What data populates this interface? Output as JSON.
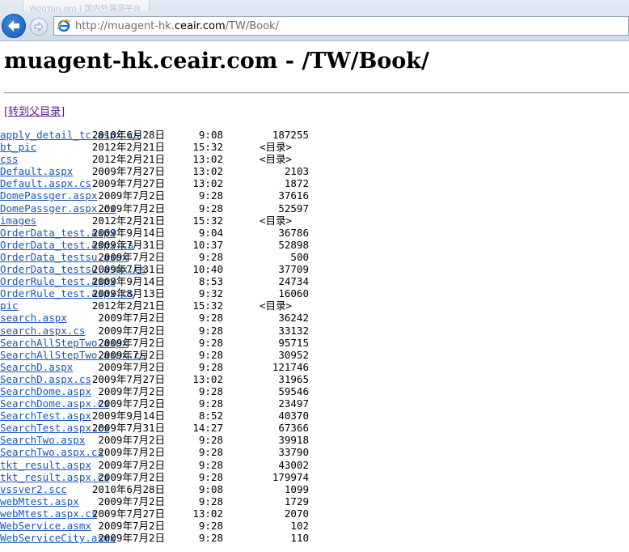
{
  "browser": {
    "ghost_tab_text": "WooYun.org | 国内外漏洞平台",
    "address": {
      "prefix": "http://muagent-hk.",
      "host": "ceair.com",
      "suffix": "/TW/Book/"
    }
  },
  "page": {
    "title": "muagent-hk.ceair.com - /TW/Book/",
    "parent_link": "[转到父目录]"
  },
  "listing": [
    {
      "date": "2010年6月28日",
      "time": "9:08",
      "size": "187255",
      "name": "apply_detail_tc.aspx.cs"
    },
    {
      "date": "2012年2月21日",
      "time": "15:32",
      "dir": "<目录>",
      "name": "bt_pic"
    },
    {
      "date": "2012年2月21日",
      "time": "13:02",
      "dir": "<目录>",
      "name": "css"
    },
    {
      "date": "2009年7月27日",
      "time": "13:02",
      "size": "2103",
      "name": "Default.aspx"
    },
    {
      "date": "2009年7月27日",
      "time": "13:02",
      "size": "1872",
      "name": "Default.aspx.cs"
    },
    {
      "date": "2009年7月2日",
      "time": "9:28",
      "size": "37616",
      "name": "DomePassger.aspx"
    },
    {
      "date": "2009年7月2日",
      "time": "9:28",
      "size": "52597",
      "name": "DomePassger.aspx.cs"
    },
    {
      "date": "2012年2月21日",
      "time": "15:32",
      "dir": "<目录>",
      "name": "images"
    },
    {
      "date": "2009年9月14日",
      "time": "9:04",
      "size": "36786",
      "name": "OrderData_test.aspx"
    },
    {
      "date": "2009年7月31日",
      "time": "10:37",
      "size": "52898",
      "name": "OrderData_test.aspx.cs"
    },
    {
      "date": "2009年7月2日",
      "time": "9:28",
      "size": "500",
      "name": "OrderData_testsu.aspx"
    },
    {
      "date": "2009年7月31日",
      "time": "10:40",
      "size": "37709",
      "name": "OrderData_testsu.aspx.cs"
    },
    {
      "date": "2009年9月14日",
      "time": "8:53",
      "size": "24734",
      "name": "OrderRule_test.aspx"
    },
    {
      "date": "2009年8月13日",
      "time": "9:32",
      "size": "16060",
      "name": "OrderRule_test.aspx.cs"
    },
    {
      "date": "2012年2月21日",
      "time": "15:32",
      "dir": "<目录>",
      "name": "pic"
    },
    {
      "date": "2009年7月2日",
      "time": "9:28",
      "size": "36242",
      "name": "search.aspx"
    },
    {
      "date": "2009年7月2日",
      "time": "9:28",
      "size": "33132",
      "name": "search.aspx.cs"
    },
    {
      "date": "2009年7月2日",
      "time": "9:28",
      "size": "95715",
      "name": "SearchAllStepTwo.aspx"
    },
    {
      "date": "2009年7月2日",
      "time": "9:28",
      "size": "30952",
      "name": "SearchAllStepTwo.aspx.cs"
    },
    {
      "date": "2009年7月2日",
      "time": "9:28",
      "size": "121746",
      "name": "SearchD.aspx"
    },
    {
      "date": "2009年7月27日",
      "time": "13:02",
      "size": "31965",
      "name": "SearchD.aspx.cs"
    },
    {
      "date": "2009年7月2日",
      "time": "9:28",
      "size": "59546",
      "name": "SearchDome.aspx"
    },
    {
      "date": "2009年7月2日",
      "time": "9:28",
      "size": "23497",
      "name": "SearchDome.aspx.cs"
    },
    {
      "date": "2009年9月14日",
      "time": "8:52",
      "size": "40370",
      "name": "SearchTest.aspx"
    },
    {
      "date": "2009年7月31日",
      "time": "14:27",
      "size": "67366",
      "name": "SearchTest.aspx.cs"
    },
    {
      "date": "2009年7月2日",
      "time": "9:28",
      "size": "39918",
      "name": "SearchTwo.aspx"
    },
    {
      "date": "2009年7月2日",
      "time": "9:28",
      "size": "33790",
      "name": "SearchTwo.aspx.cs"
    },
    {
      "date": "2009年7月2日",
      "time": "9:28",
      "size": "43002",
      "name": "tkt_result.aspx"
    },
    {
      "date": "2009年7月2日",
      "time": "9:28",
      "size": "179974",
      "name": "tkt_result.aspx.cs"
    },
    {
      "date": "2010年6月28日",
      "time": "9:08",
      "size": "1099",
      "name": "vssver2.scc"
    },
    {
      "date": "2009年7月2日",
      "time": "9:28",
      "size": "1729",
      "name": "webMtest.aspx"
    },
    {
      "date": "2009年7月27日",
      "time": "13:02",
      "size": "2070",
      "name": "webMtest.aspx.cs"
    },
    {
      "date": "2009年7月2日",
      "time": "9:28",
      "size": "102",
      "name": "WebService.asmx"
    },
    {
      "date": "2009年7月2日",
      "time": "9:28",
      "size": "110",
      "name": "WebServiceCity.asmx"
    }
  ]
}
